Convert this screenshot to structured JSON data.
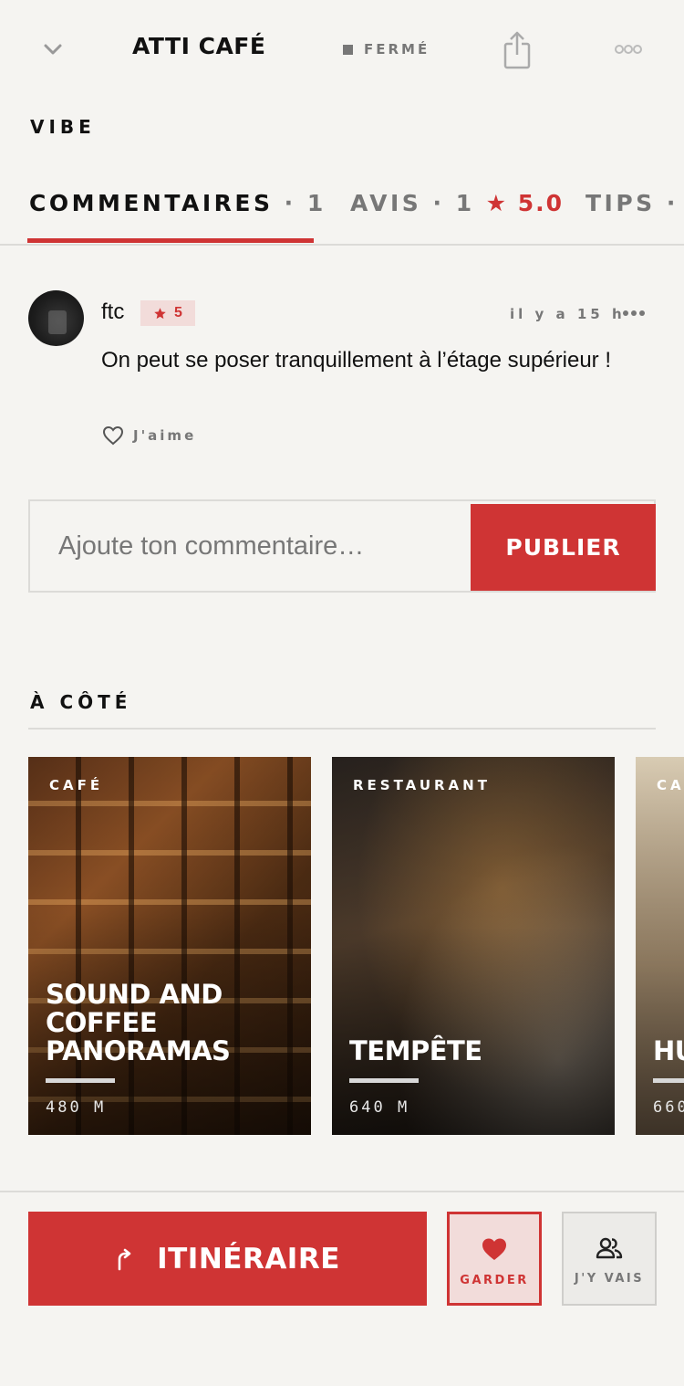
{
  "header": {
    "venue_name": "ATTI CAFÉ",
    "status": "FERMÉ"
  },
  "vibe": {
    "label": "VIBE"
  },
  "tabs": [
    {
      "label": "COMMENTAIRES",
      "count": "· 1",
      "active": true
    },
    {
      "label": "AVIS",
      "count": "· 1",
      "rating": "★ 5.0",
      "active": false
    },
    {
      "label": "TIPS",
      "count": "·",
      "active": false
    }
  ],
  "comment": {
    "user": "ftc",
    "rating": "5",
    "time": "il y a 15 h",
    "text": "On peut se poser tranquillement à l’étage supérieur !",
    "like_label": "J'aime"
  },
  "comment_form": {
    "placeholder": "Ajoute ton commentaire…",
    "submit_label": "PUBLIER"
  },
  "nearby": {
    "label": "À CÔTÉ",
    "places": [
      {
        "category": "CAFÉ",
        "name": "SOUND AND COFFEE PANORAMAS",
        "distance": "480 M"
      },
      {
        "category": "RESTAURANT",
        "name": "TEMPÊTE",
        "distance": "640 M"
      },
      {
        "category": "CA",
        "name": "HU",
        "distance": "660"
      }
    ]
  },
  "actions": {
    "route_label": "ITINÉRAIRE",
    "save_label": "GARDER",
    "going_label": "J'Y VAIS"
  },
  "colors": {
    "accent": "#cf3434",
    "background": "#f5f4f1",
    "muted": "#777777"
  },
  "icons": [
    "chevron-down-icon",
    "share-icon",
    "more-icon",
    "star-icon",
    "heart-outline-icon",
    "heart-icon",
    "turn-right-arrow-icon",
    "people-icon"
  ]
}
